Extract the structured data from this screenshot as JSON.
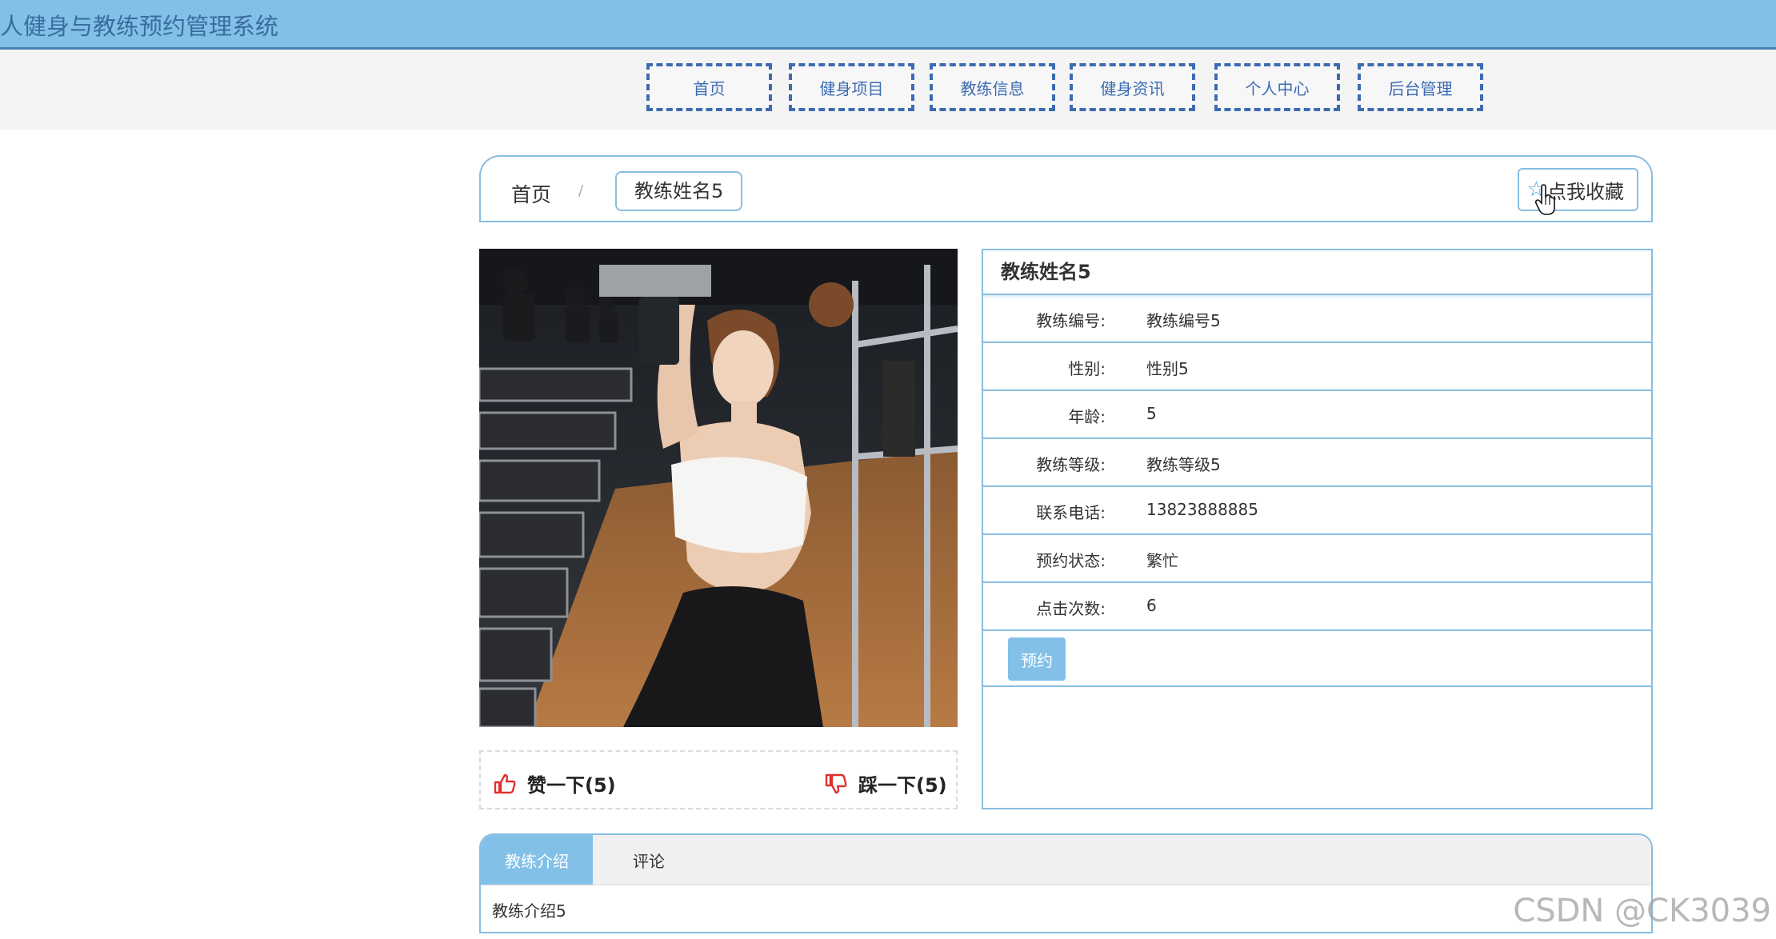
{
  "header": {
    "title": "人健身与教练预约管理系统"
  },
  "nav": {
    "items": [
      {
        "label": "首页"
      },
      {
        "label": "健身项目"
      },
      {
        "label": "教练信息"
      },
      {
        "label": "健身资讯"
      },
      {
        "label": "个人中心"
      },
      {
        "label": "后台管理"
      }
    ]
  },
  "breadcrumb": {
    "home": "首页",
    "separator": "/",
    "current": "教练姓名5"
  },
  "favorite": {
    "label": "点我收藏",
    "icon": "star-outline-icon"
  },
  "photo": {
    "description_icon": "coach-photo"
  },
  "votes": {
    "like_label": "赞一下(5)",
    "dislike_label": "踩一下(5)",
    "like_icon": "thumbs-up-icon",
    "dislike_icon": "thumbs-down-icon"
  },
  "info": {
    "name": "教练姓名5",
    "rows": [
      {
        "label": "教练编号:",
        "value": "教练编号5"
      },
      {
        "label": "性别:",
        "value": "性别5"
      },
      {
        "label": "年龄:",
        "value": "5"
      },
      {
        "label": "教练等级:",
        "value": "教练等级5"
      },
      {
        "label": "联系电话:",
        "value": "13823888885"
      },
      {
        "label": "预约状态:",
        "value": "繁忙"
      },
      {
        "label": "点击次数:",
        "value": "6"
      }
    ],
    "book_label": "预约"
  },
  "tabs": {
    "items": [
      {
        "label": "教练介绍"
      },
      {
        "label": "评论"
      }
    ],
    "content": "教练介绍5"
  },
  "watermark": "CSDN @CK3039",
  "colors": {
    "header_bg": "#82c0e8",
    "nav_border": "#3d6bb3",
    "panel_border": "#88bde0",
    "accent": "#82c0e8",
    "vote_icon": "#e03030"
  }
}
